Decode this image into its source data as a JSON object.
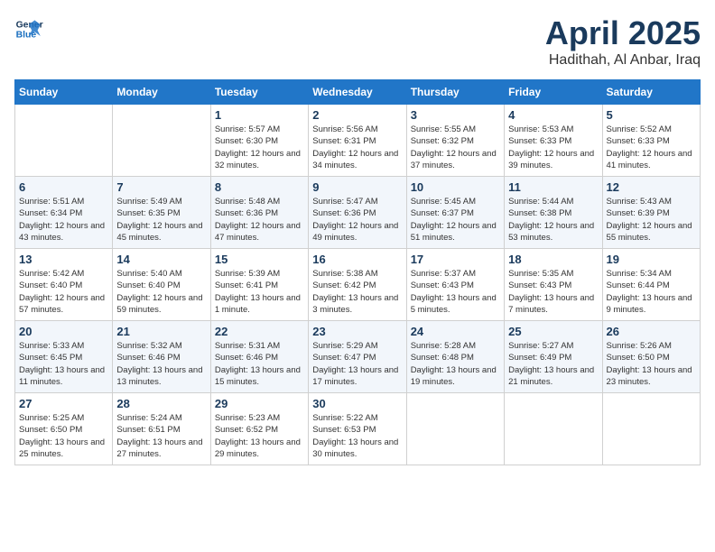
{
  "header": {
    "logo_line1": "General",
    "logo_line2": "Blue",
    "month": "April 2025",
    "location": "Hadithah, Al Anbar, Iraq"
  },
  "days_of_week": [
    "Sunday",
    "Monday",
    "Tuesday",
    "Wednesday",
    "Thursday",
    "Friday",
    "Saturday"
  ],
  "weeks": [
    [
      {
        "day": "",
        "sunrise": "",
        "sunset": "",
        "daylight": "",
        "empty": true
      },
      {
        "day": "",
        "sunrise": "",
        "sunset": "",
        "daylight": "",
        "empty": true
      },
      {
        "day": "1",
        "sunrise": "Sunrise: 5:57 AM",
        "sunset": "Sunset: 6:30 PM",
        "daylight": "Daylight: 12 hours and 32 minutes."
      },
      {
        "day": "2",
        "sunrise": "Sunrise: 5:56 AM",
        "sunset": "Sunset: 6:31 PM",
        "daylight": "Daylight: 12 hours and 34 minutes."
      },
      {
        "day": "3",
        "sunrise": "Sunrise: 5:55 AM",
        "sunset": "Sunset: 6:32 PM",
        "daylight": "Daylight: 12 hours and 37 minutes."
      },
      {
        "day": "4",
        "sunrise": "Sunrise: 5:53 AM",
        "sunset": "Sunset: 6:33 PM",
        "daylight": "Daylight: 12 hours and 39 minutes."
      },
      {
        "day": "5",
        "sunrise": "Sunrise: 5:52 AM",
        "sunset": "Sunset: 6:33 PM",
        "daylight": "Daylight: 12 hours and 41 minutes."
      }
    ],
    [
      {
        "day": "6",
        "sunrise": "Sunrise: 5:51 AM",
        "sunset": "Sunset: 6:34 PM",
        "daylight": "Daylight: 12 hours and 43 minutes."
      },
      {
        "day": "7",
        "sunrise": "Sunrise: 5:49 AM",
        "sunset": "Sunset: 6:35 PM",
        "daylight": "Daylight: 12 hours and 45 minutes."
      },
      {
        "day": "8",
        "sunrise": "Sunrise: 5:48 AM",
        "sunset": "Sunset: 6:36 PM",
        "daylight": "Daylight: 12 hours and 47 minutes."
      },
      {
        "day": "9",
        "sunrise": "Sunrise: 5:47 AM",
        "sunset": "Sunset: 6:36 PM",
        "daylight": "Daylight: 12 hours and 49 minutes."
      },
      {
        "day": "10",
        "sunrise": "Sunrise: 5:45 AM",
        "sunset": "Sunset: 6:37 PM",
        "daylight": "Daylight: 12 hours and 51 minutes."
      },
      {
        "day": "11",
        "sunrise": "Sunrise: 5:44 AM",
        "sunset": "Sunset: 6:38 PM",
        "daylight": "Daylight: 12 hours and 53 minutes."
      },
      {
        "day": "12",
        "sunrise": "Sunrise: 5:43 AM",
        "sunset": "Sunset: 6:39 PM",
        "daylight": "Daylight: 12 hours and 55 minutes."
      }
    ],
    [
      {
        "day": "13",
        "sunrise": "Sunrise: 5:42 AM",
        "sunset": "Sunset: 6:40 PM",
        "daylight": "Daylight: 12 hours and 57 minutes."
      },
      {
        "day": "14",
        "sunrise": "Sunrise: 5:40 AM",
        "sunset": "Sunset: 6:40 PM",
        "daylight": "Daylight: 12 hours and 59 minutes."
      },
      {
        "day": "15",
        "sunrise": "Sunrise: 5:39 AM",
        "sunset": "Sunset: 6:41 PM",
        "daylight": "Daylight: 13 hours and 1 minute."
      },
      {
        "day": "16",
        "sunrise": "Sunrise: 5:38 AM",
        "sunset": "Sunset: 6:42 PM",
        "daylight": "Daylight: 13 hours and 3 minutes."
      },
      {
        "day": "17",
        "sunrise": "Sunrise: 5:37 AM",
        "sunset": "Sunset: 6:43 PM",
        "daylight": "Daylight: 13 hours and 5 minutes."
      },
      {
        "day": "18",
        "sunrise": "Sunrise: 5:35 AM",
        "sunset": "Sunset: 6:43 PM",
        "daylight": "Daylight: 13 hours and 7 minutes."
      },
      {
        "day": "19",
        "sunrise": "Sunrise: 5:34 AM",
        "sunset": "Sunset: 6:44 PM",
        "daylight": "Daylight: 13 hours and 9 minutes."
      }
    ],
    [
      {
        "day": "20",
        "sunrise": "Sunrise: 5:33 AM",
        "sunset": "Sunset: 6:45 PM",
        "daylight": "Daylight: 13 hours and 11 minutes."
      },
      {
        "day": "21",
        "sunrise": "Sunrise: 5:32 AM",
        "sunset": "Sunset: 6:46 PM",
        "daylight": "Daylight: 13 hours and 13 minutes."
      },
      {
        "day": "22",
        "sunrise": "Sunrise: 5:31 AM",
        "sunset": "Sunset: 6:46 PM",
        "daylight": "Daylight: 13 hours and 15 minutes."
      },
      {
        "day": "23",
        "sunrise": "Sunrise: 5:29 AM",
        "sunset": "Sunset: 6:47 PM",
        "daylight": "Daylight: 13 hours and 17 minutes."
      },
      {
        "day": "24",
        "sunrise": "Sunrise: 5:28 AM",
        "sunset": "Sunset: 6:48 PM",
        "daylight": "Daylight: 13 hours and 19 minutes."
      },
      {
        "day": "25",
        "sunrise": "Sunrise: 5:27 AM",
        "sunset": "Sunset: 6:49 PM",
        "daylight": "Daylight: 13 hours and 21 minutes."
      },
      {
        "day": "26",
        "sunrise": "Sunrise: 5:26 AM",
        "sunset": "Sunset: 6:50 PM",
        "daylight": "Daylight: 13 hours and 23 minutes."
      }
    ],
    [
      {
        "day": "27",
        "sunrise": "Sunrise: 5:25 AM",
        "sunset": "Sunset: 6:50 PM",
        "daylight": "Daylight: 13 hours and 25 minutes."
      },
      {
        "day": "28",
        "sunrise": "Sunrise: 5:24 AM",
        "sunset": "Sunset: 6:51 PM",
        "daylight": "Daylight: 13 hours and 27 minutes."
      },
      {
        "day": "29",
        "sunrise": "Sunrise: 5:23 AM",
        "sunset": "Sunset: 6:52 PM",
        "daylight": "Daylight: 13 hours and 29 minutes."
      },
      {
        "day": "30",
        "sunrise": "Sunrise: 5:22 AM",
        "sunset": "Sunset: 6:53 PM",
        "daylight": "Daylight: 13 hours and 30 minutes."
      },
      {
        "day": "",
        "sunrise": "",
        "sunset": "",
        "daylight": "",
        "empty": true
      },
      {
        "day": "",
        "sunrise": "",
        "sunset": "",
        "daylight": "",
        "empty": true
      },
      {
        "day": "",
        "sunrise": "",
        "sunset": "",
        "daylight": "",
        "empty": true
      }
    ]
  ]
}
